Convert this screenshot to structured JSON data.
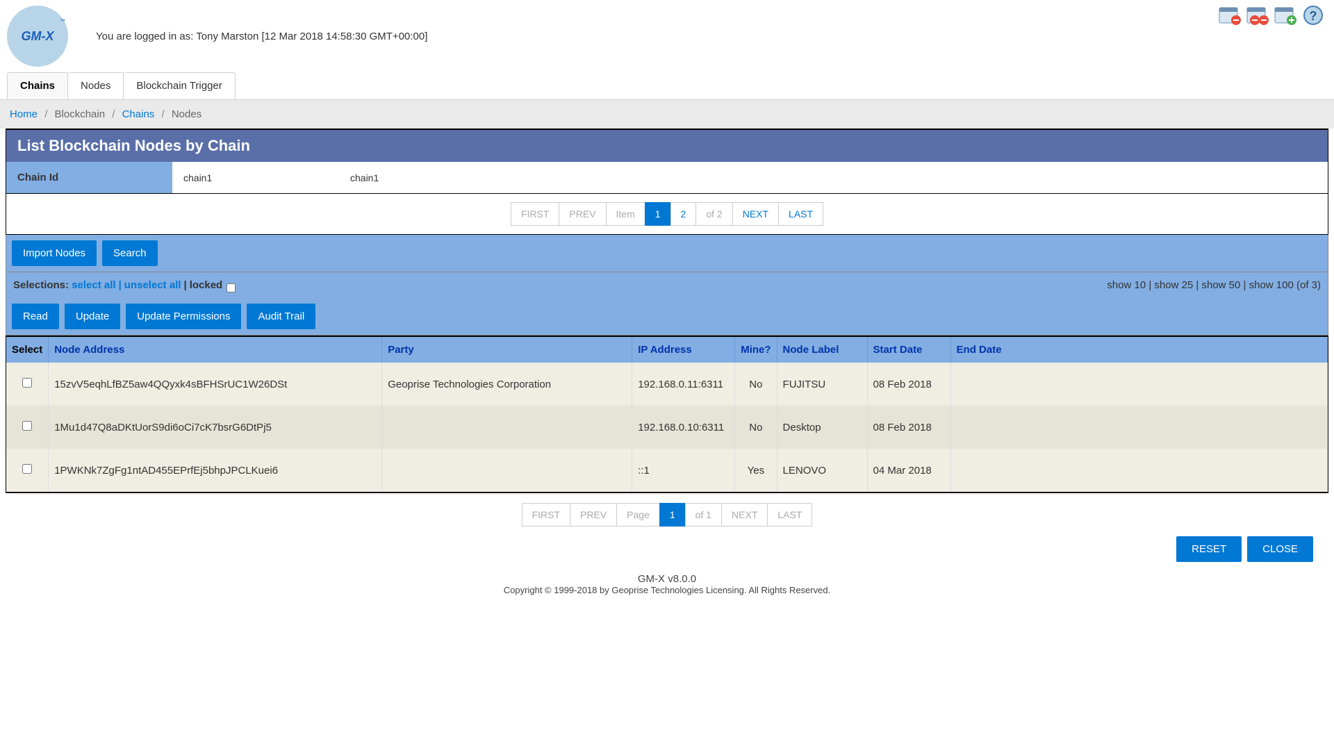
{
  "header": {
    "logo_text": "GM-X",
    "login_info": "You are logged in as: Tony Marston [12 Mar 2018 14:58:30 GMT+00:00]"
  },
  "tabs": [
    {
      "label": "Chains",
      "active": true
    },
    {
      "label": "Nodes",
      "active": false
    },
    {
      "label": "Blockchain Trigger",
      "active": false
    }
  ],
  "breadcrumb": {
    "home": "Home",
    "blockchain": "Blockchain",
    "chains": "Chains",
    "nodes": "Nodes"
  },
  "page_title": "List Blockchain Nodes by Chain",
  "chain": {
    "label": "Chain Id",
    "value1": "chain1",
    "value2": "chain1"
  },
  "item_pager": {
    "first": "FIRST",
    "prev": "PREV",
    "item": "Item",
    "p1": "1",
    "p2": "2",
    "of": "of 2",
    "next": "NEXT",
    "last": "LAST"
  },
  "actions": {
    "import_nodes": "Import Nodes",
    "search": "Search",
    "read": "Read",
    "update": "Update",
    "update_perm": "Update Permissions",
    "audit": "Audit Trail"
  },
  "selection": {
    "label": "Selections:",
    "select_all": "select all",
    "unselect_all": "unselect all",
    "locked": "locked",
    "page_size": "show 10 | show 25 | show 50 | show 100 (of 3)"
  },
  "table": {
    "headers": {
      "select": "Select",
      "node_address": "Node Address",
      "party": "Party",
      "ip": "IP Address",
      "mine": "Mine?",
      "label": "Node Label",
      "start": "Start Date",
      "end": "End Date"
    },
    "rows": [
      {
        "node": "15zvV5eqhLfBZ5aw4QQyxk4sBFHSrUC1W26DSt",
        "party": "Geoprise Technologies Corporation",
        "ip": "192.168.0.11:6311",
        "mine": "No",
        "label": "FUJITSU",
        "start": "08 Feb 2018",
        "end": ""
      },
      {
        "node": "1Mu1d47Q8aDKtUorS9di6oCi7cK7bsrG6DtPj5",
        "party": "",
        "ip": "192.168.0.10:6311",
        "mine": "No",
        "label": "Desktop",
        "start": "08 Feb 2018",
        "end": ""
      },
      {
        "node": "1PWKNk7ZgFg1ntAD455EPrfEj5bhpJPCLKuei6",
        "party": "",
        "ip": "::1",
        "mine": "Yes",
        "label": "LENOVO",
        "start": "04 Mar 2018",
        "end": ""
      }
    ]
  },
  "page_pager": {
    "first": "FIRST",
    "prev": "PREV",
    "page": "Page",
    "p1": "1",
    "of": "of 1",
    "next": "NEXT",
    "last": "LAST"
  },
  "bottom": {
    "reset": "RESET",
    "close": "CLOSE"
  },
  "footer": {
    "version": "GM-X v8.0.0",
    "copyright": "Copyright © 1999-2018 by Geoprise Technologies Licensing. All Rights Reserved."
  }
}
